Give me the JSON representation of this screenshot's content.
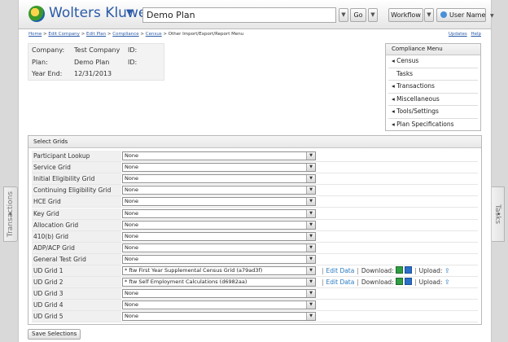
{
  "header": {
    "brand": "Wolters Kluwer",
    "plan_name": "Demo Plan",
    "go_label": "Go",
    "workflow_label": "Workflow",
    "user_label": "User Name"
  },
  "breadcrumb": {
    "items": [
      "Home",
      "Edit Company",
      "Edit Plan",
      "Compliance",
      "Census"
    ],
    "current": "Other Import/Export/Report Menu",
    "separator": ">",
    "updates": "Updates",
    "help": "Help"
  },
  "plan_info": {
    "company_label": "Company:",
    "company_value": "Test Company",
    "company_id_label": "ID:",
    "plan_label": "Plan:",
    "plan_value": "Demo Plan",
    "plan_id_label": "ID:",
    "year_end_label": "Year End:",
    "year_end_value": "12/31/2013"
  },
  "compliance_menu": {
    "title": "Compliance Menu",
    "items": [
      "Census",
      "Tasks",
      "Transactions",
      "Miscellaneous",
      "Tools/Settings",
      "Plan Specifications"
    ]
  },
  "grids": {
    "title": "Select Grids",
    "rows": [
      {
        "label": "Participant Lookup",
        "value": "None"
      },
      {
        "label": "Service Grid",
        "value": "None"
      },
      {
        "label": "Initial Eligibility Grid",
        "value": "None"
      },
      {
        "label": "Continuing Eligibility Grid",
        "value": "None"
      },
      {
        "label": "HCE Grid",
        "value": "None"
      },
      {
        "label": "Key Grid",
        "value": "None"
      },
      {
        "label": "Allocation Grid",
        "value": "None"
      },
      {
        "label": "410(b) Grid",
        "value": "None"
      },
      {
        "label": "ADP/ACP Grid",
        "value": "None"
      },
      {
        "label": "General Test Grid",
        "value": "None"
      },
      {
        "label": "UD Grid 1",
        "value": "* ftw First Year Supplemental Census Grid (a79ad3f)"
      },
      {
        "label": "UD Grid 2",
        "value": "* ftw Self Employment Calculations (d6982aa)"
      },
      {
        "label": "UD Grid 3",
        "value": "None"
      },
      {
        "label": "UD Grid 4",
        "value": "None"
      },
      {
        "label": "UD Grid 5",
        "value": "None"
      }
    ],
    "edit_data_label": "Edit Data",
    "download_label": "Download:",
    "upload_label": "Upload:"
  },
  "save_label": "Save Selections",
  "side_tabs": {
    "left": "Transactions",
    "right": "Tasks"
  },
  "colors": {
    "brand_blue": "#2a5aa8",
    "link_blue": "#2a7ac0",
    "excel_green": "#2f9e44"
  }
}
